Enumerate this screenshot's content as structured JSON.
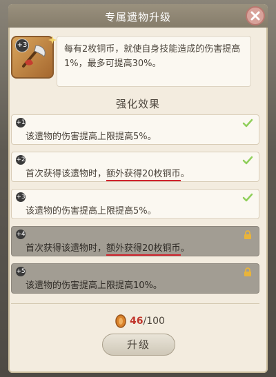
{
  "window": {
    "title": "专属遗物升级"
  },
  "relic": {
    "level_badge": "+3",
    "description": "每有2枚铜币，就使自身技能造成的伤害提高1%，最多可提高30%。"
  },
  "effects_section": {
    "title": "强化效果"
  },
  "effects": [
    {
      "badge": "+1",
      "text": "该遗物的伤害提高上限提高5%。",
      "status": "unlocked"
    },
    {
      "badge": "+2",
      "text_pre": "首次获得该遗物时，",
      "text_highlight": "额外获得20枚铜币",
      "text_post": "。",
      "status": "unlocked"
    },
    {
      "badge": "+3",
      "text": "该遗物的伤害提高上限提高5%。",
      "status": "unlocked"
    },
    {
      "badge": "+4",
      "text_pre": "首次获得该遗物时，",
      "text_highlight": "额外获得20枚铜币",
      "text_post": "。",
      "status": "locked"
    },
    {
      "badge": "+5",
      "text": "该遗物的伤害提高上限提高10%。",
      "status": "locked"
    }
  ],
  "cost": {
    "current": "46",
    "separator_total": "/100"
  },
  "upgrade_button": {
    "label": "升级"
  },
  "colors": {
    "check": "#8fcf5a",
    "lock": "#e9b43a",
    "highlight_underline": "#d0232c"
  }
}
